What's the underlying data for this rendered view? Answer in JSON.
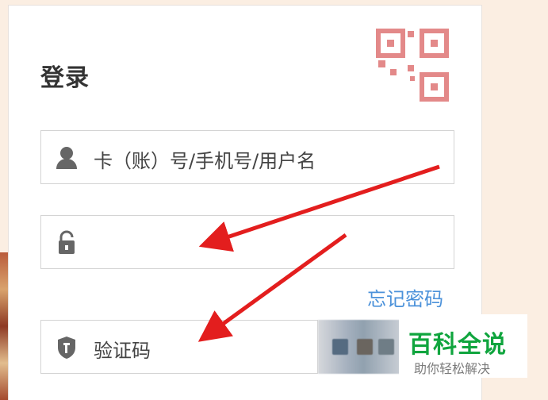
{
  "login": {
    "title": "登录",
    "fields": {
      "username_placeholder": "卡（账）号/手机号/用户名",
      "password_value": "",
      "captcha_placeholder": "验证码"
    },
    "forgot_password": "忘记密码"
  },
  "icons": {
    "qr": "qr-code-icon",
    "user": "user-icon",
    "lock": "lock-icon",
    "shield": "shield-icon"
  },
  "watermark": {
    "main": "百科全说",
    "sub": "助你轻松解决"
  },
  "colors": {
    "page_background": "#fbeee2",
    "panel_background": "#ffffff",
    "border": "#d4d4d4",
    "title": "#333333",
    "link": "#4c92da",
    "qr_icon": "#e38989",
    "arrow": "#e31e1e",
    "watermark_main": "#10a53e",
    "watermark_sub": "#7b7b7b"
  }
}
